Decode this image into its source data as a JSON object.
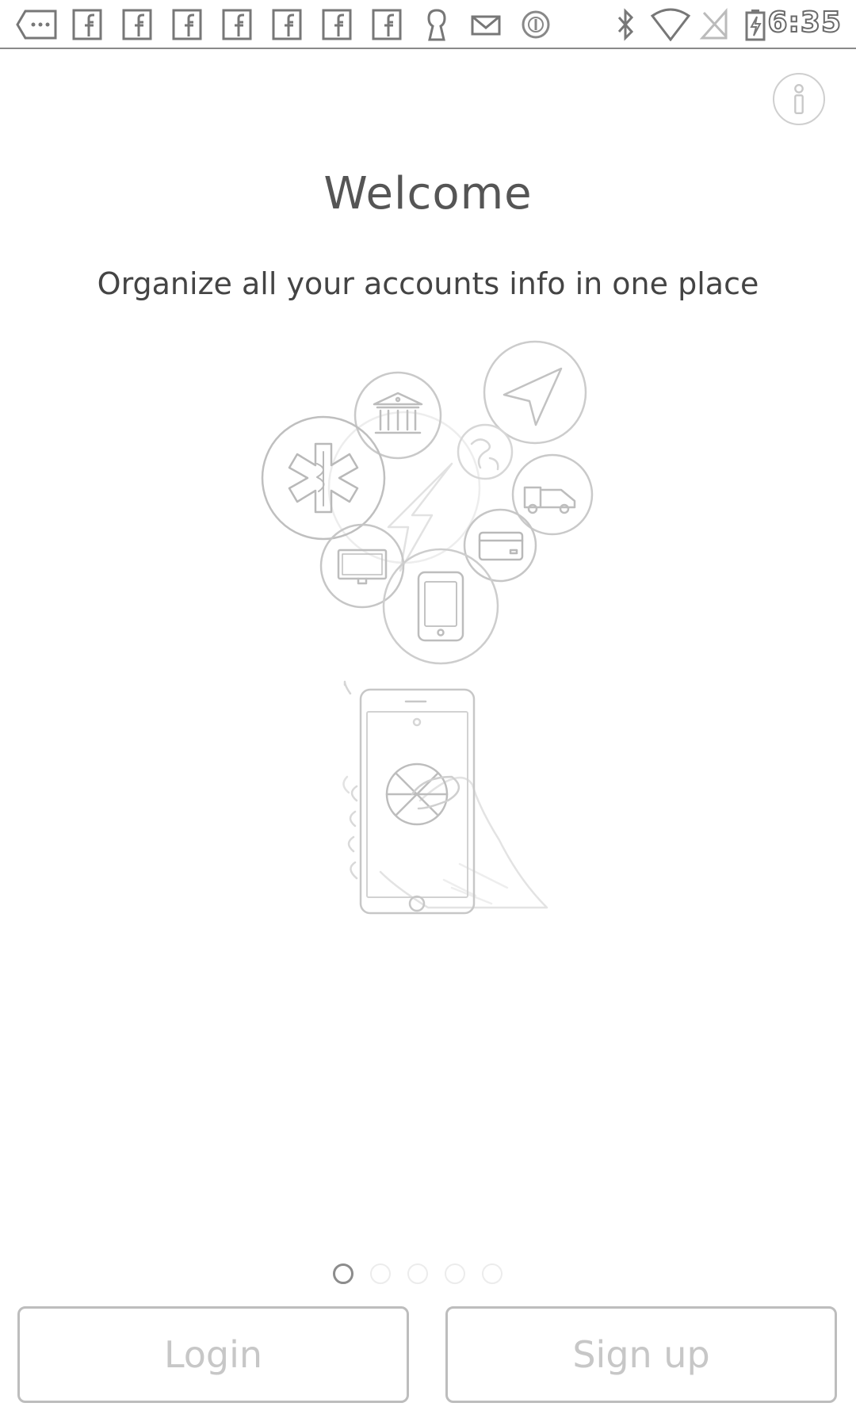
{
  "status_bar": {
    "time": "6:35",
    "left_icons": [
      "more-icon",
      "facebook-icon",
      "facebook-icon",
      "facebook-icon",
      "facebook-icon",
      "facebook-icon",
      "facebook-icon",
      "facebook-icon",
      "keyhole-icon",
      "mail-icon",
      "circle-icon"
    ],
    "right_icons": [
      "bluetooth-icon",
      "wifi-icon",
      "no-signal-icon",
      "battery-charging-icon"
    ]
  },
  "header": {
    "info_icon": "info-icon"
  },
  "main": {
    "title": "Welcome",
    "subtitle": "Organize all your accounts info in one place",
    "illustration_icons": [
      "bank-icon",
      "navigation-icon",
      "medical-icon",
      "globe-icon",
      "truck-icon",
      "lightning-icon",
      "monitor-icon",
      "credit-card-icon",
      "smartphone-icon"
    ]
  },
  "pager": {
    "page_count": 5,
    "current_page": 1
  },
  "actions": {
    "login_label": "Login",
    "signup_label": "Sign up"
  }
}
